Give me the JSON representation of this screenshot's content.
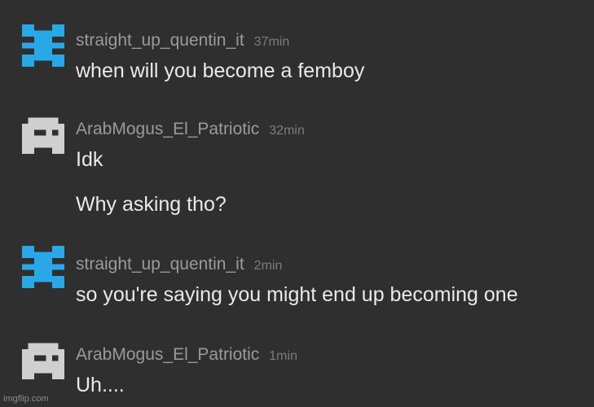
{
  "colors": {
    "background": "#2f2f2f",
    "username": "#9a9a9a",
    "timestamp": "#7c7c7c",
    "message_text": "#e9e9e9",
    "avatar_blue": "#29a8e8",
    "avatar_gray": "#cfcfcf"
  },
  "messages": [
    {
      "avatar": "blue-pixel-avatar-icon",
      "username": "straight_up_quentin_it",
      "time": "37min",
      "lines": [
        "when will you become a femboy"
      ]
    },
    {
      "avatar": "gray-pixel-avatar-icon",
      "username": "ArabMogus_El_Patriotic",
      "time": "32min",
      "lines": [
        "Idk",
        "Why asking tho?"
      ]
    },
    {
      "avatar": "blue-pixel-avatar-icon",
      "username": "straight_up_quentin_it",
      "time": "2min",
      "lines": [
        "so you're saying you might end up becoming one"
      ]
    },
    {
      "avatar": "gray-pixel-avatar-icon",
      "username": "ArabMogus_El_Patriotic",
      "time": "1min",
      "lines": [
        "Uh...."
      ]
    }
  ],
  "watermark": "imgflip.com"
}
